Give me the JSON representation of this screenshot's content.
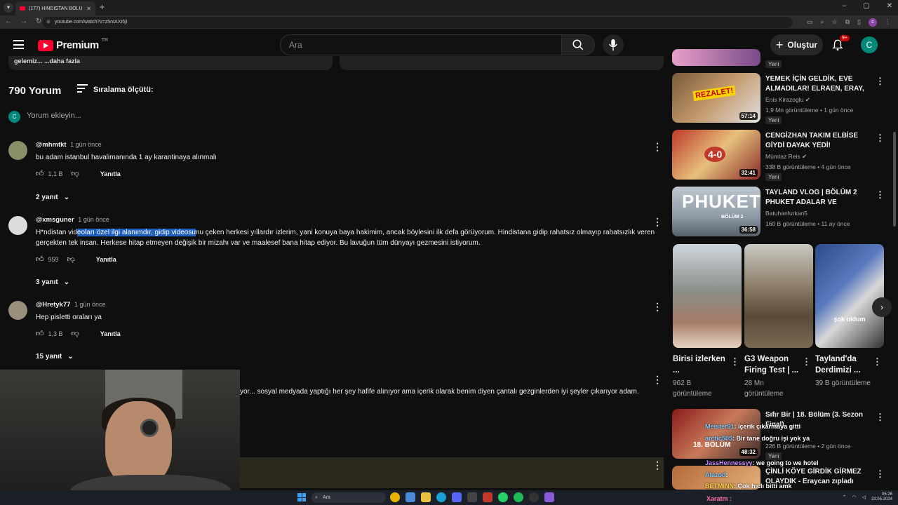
{
  "browser": {
    "tab_title": "(177) HİNDİSTAN BÖLÜM 2: Vi",
    "url": "youtube.com/watch?v=z5ntAXI5jI"
  },
  "header": {
    "brand": "Premium",
    "country": "TR",
    "search_placeholder": "Ara",
    "create_label": "Oluştur",
    "notif_badge": "9+",
    "avatar_letter": "C"
  },
  "desc_strip": "gelemiz... ...daha fazla",
  "comments_header": {
    "count": "790 Yorum",
    "sort_label": "Sıralama ölçütü:",
    "add_placeholder": "Yorum ekleyin..."
  },
  "comments": [
    {
      "user": "@mhmtkt",
      "time": "1 gün önce",
      "text": "bu adam istanbul havalimanında 1 ay karantinaya alınmalı",
      "likes": "1,1 B",
      "reply_label": "Yanıtla",
      "replies": "2 yanıt"
    },
    {
      "user": "@xmsguner",
      "time": "1 gün önce",
      "text_pre": "H*ndistan vid",
      "text_hl": "eoları özel ilgi alanımdır, gidip videosu",
      "text_post": "nu çeken herkesi yıllardır izlerim, yani konuya baya hakimim, ancak böylesini ilk defa görüyorum. Hindistana gidip rahatsız olmayıp rahatsızlık veren gerçekten tek insan. Herkese hitap etmeyen değişik bir mizahı var ve maalesef bana hitap ediyor. Bu lavuğun tüm dünyayı gezmesini istiyorum.",
      "likes": "959",
      "reply_label": "Yanıtla",
      "replies": "3 yanıt"
    },
    {
      "user": "@Hretyk77",
      "time": "1 gün önce",
      "text": "Hep pisletti oraları ya",
      "likes": "1,3 B",
      "reply_label": "Yanıtla",
      "replies": "15 yanıt"
    }
  ],
  "partial_comment": "yor... sosyal medyada yaptığı her şey hafife alınıyor ama içerik olarak benim diyen çantalı gezginlerden iyi şeyler çıkarıyor adam.",
  "sidebar": {
    "top_new": "Yeni",
    "videos": [
      {
        "title": "YEMEK İÇİN GELDİK, EVE ALMADILAR! ELRAEN, ERAY, ...",
        "channel": "Enis Kirazoglu",
        "meta": "1,9 Mn görüntüleme • 1 gün önce",
        "duration": "57:14",
        "new": "Yeni",
        "thumb_text": "REZALET!"
      },
      {
        "title": "CENGİZHAN TAKIM ELBİSE GİYDİ DAYAK YEDİ! LİVERPOO...",
        "channel": "Mümtaz Reis",
        "meta": "338 B görüntüleme • 4 gün önce",
        "duration": "32:41",
        "new": "Yeni",
        "thumb_text": "4-0"
      },
      {
        "title": "TAYLAND VLOG | BÖLÜM 2 PHUKET ADALAR VE PHUKET...",
        "channel": "Batuhanfurkan5",
        "meta": "160 B görüntüleme • 11 ay önce",
        "duration": "36:58",
        "thumb_text": "PHUKET",
        "thumb_sub": "BÖLÜM 2"
      }
    ],
    "shorts": [
      {
        "title": "Birisi izlerken ...",
        "views": "962 B görüntüleme"
      },
      {
        "title": "G3 Weapon Firing Test | ...",
        "views": "28 Mn görüntüleme"
      },
      {
        "title": "Tayland'da Derdimizi ...",
        "views": "39 B görüntüleme",
        "caption": "şok oldum"
      }
    ],
    "bottom_videos": [
      {
        "title": "Sıfır Bir | 18. Bölüm (3. Sezon Final)",
        "meta": "226 B görüntüleme • 2 gün önce",
        "duration": "48:32",
        "new": "Yeni",
        "thumb_text": "18. BÖLÜM"
      },
      {
        "title": "ÇİNLİ KÖYE GİRDİK GİRMEZ OLAYDIK - Eraycan zıpladı"
      }
    ]
  },
  "chat": [
    {
      "name": "Meister91",
      "msg": ": içerik çıkarmaya gitti"
    },
    {
      "name": "arctic505",
      "msg": ": Bir tane doğru işi yok ya"
    },
    {
      "name": "JassHennessyy",
      "msg": ": we going to we hotel"
    },
    {
      "name": "Alazod",
      "msg": ":"
    },
    {
      "name": "BETMINN",
      "msg": ": Çok hıclı bitti amk"
    }
  ],
  "xaratm": "Xaratm :",
  "taskbar": {
    "search": "Ara",
    "time": "05:26",
    "date": "23.05.2024"
  },
  "colors": {
    "accent": "#ff0033",
    "highlight": "#1f5fbf"
  }
}
